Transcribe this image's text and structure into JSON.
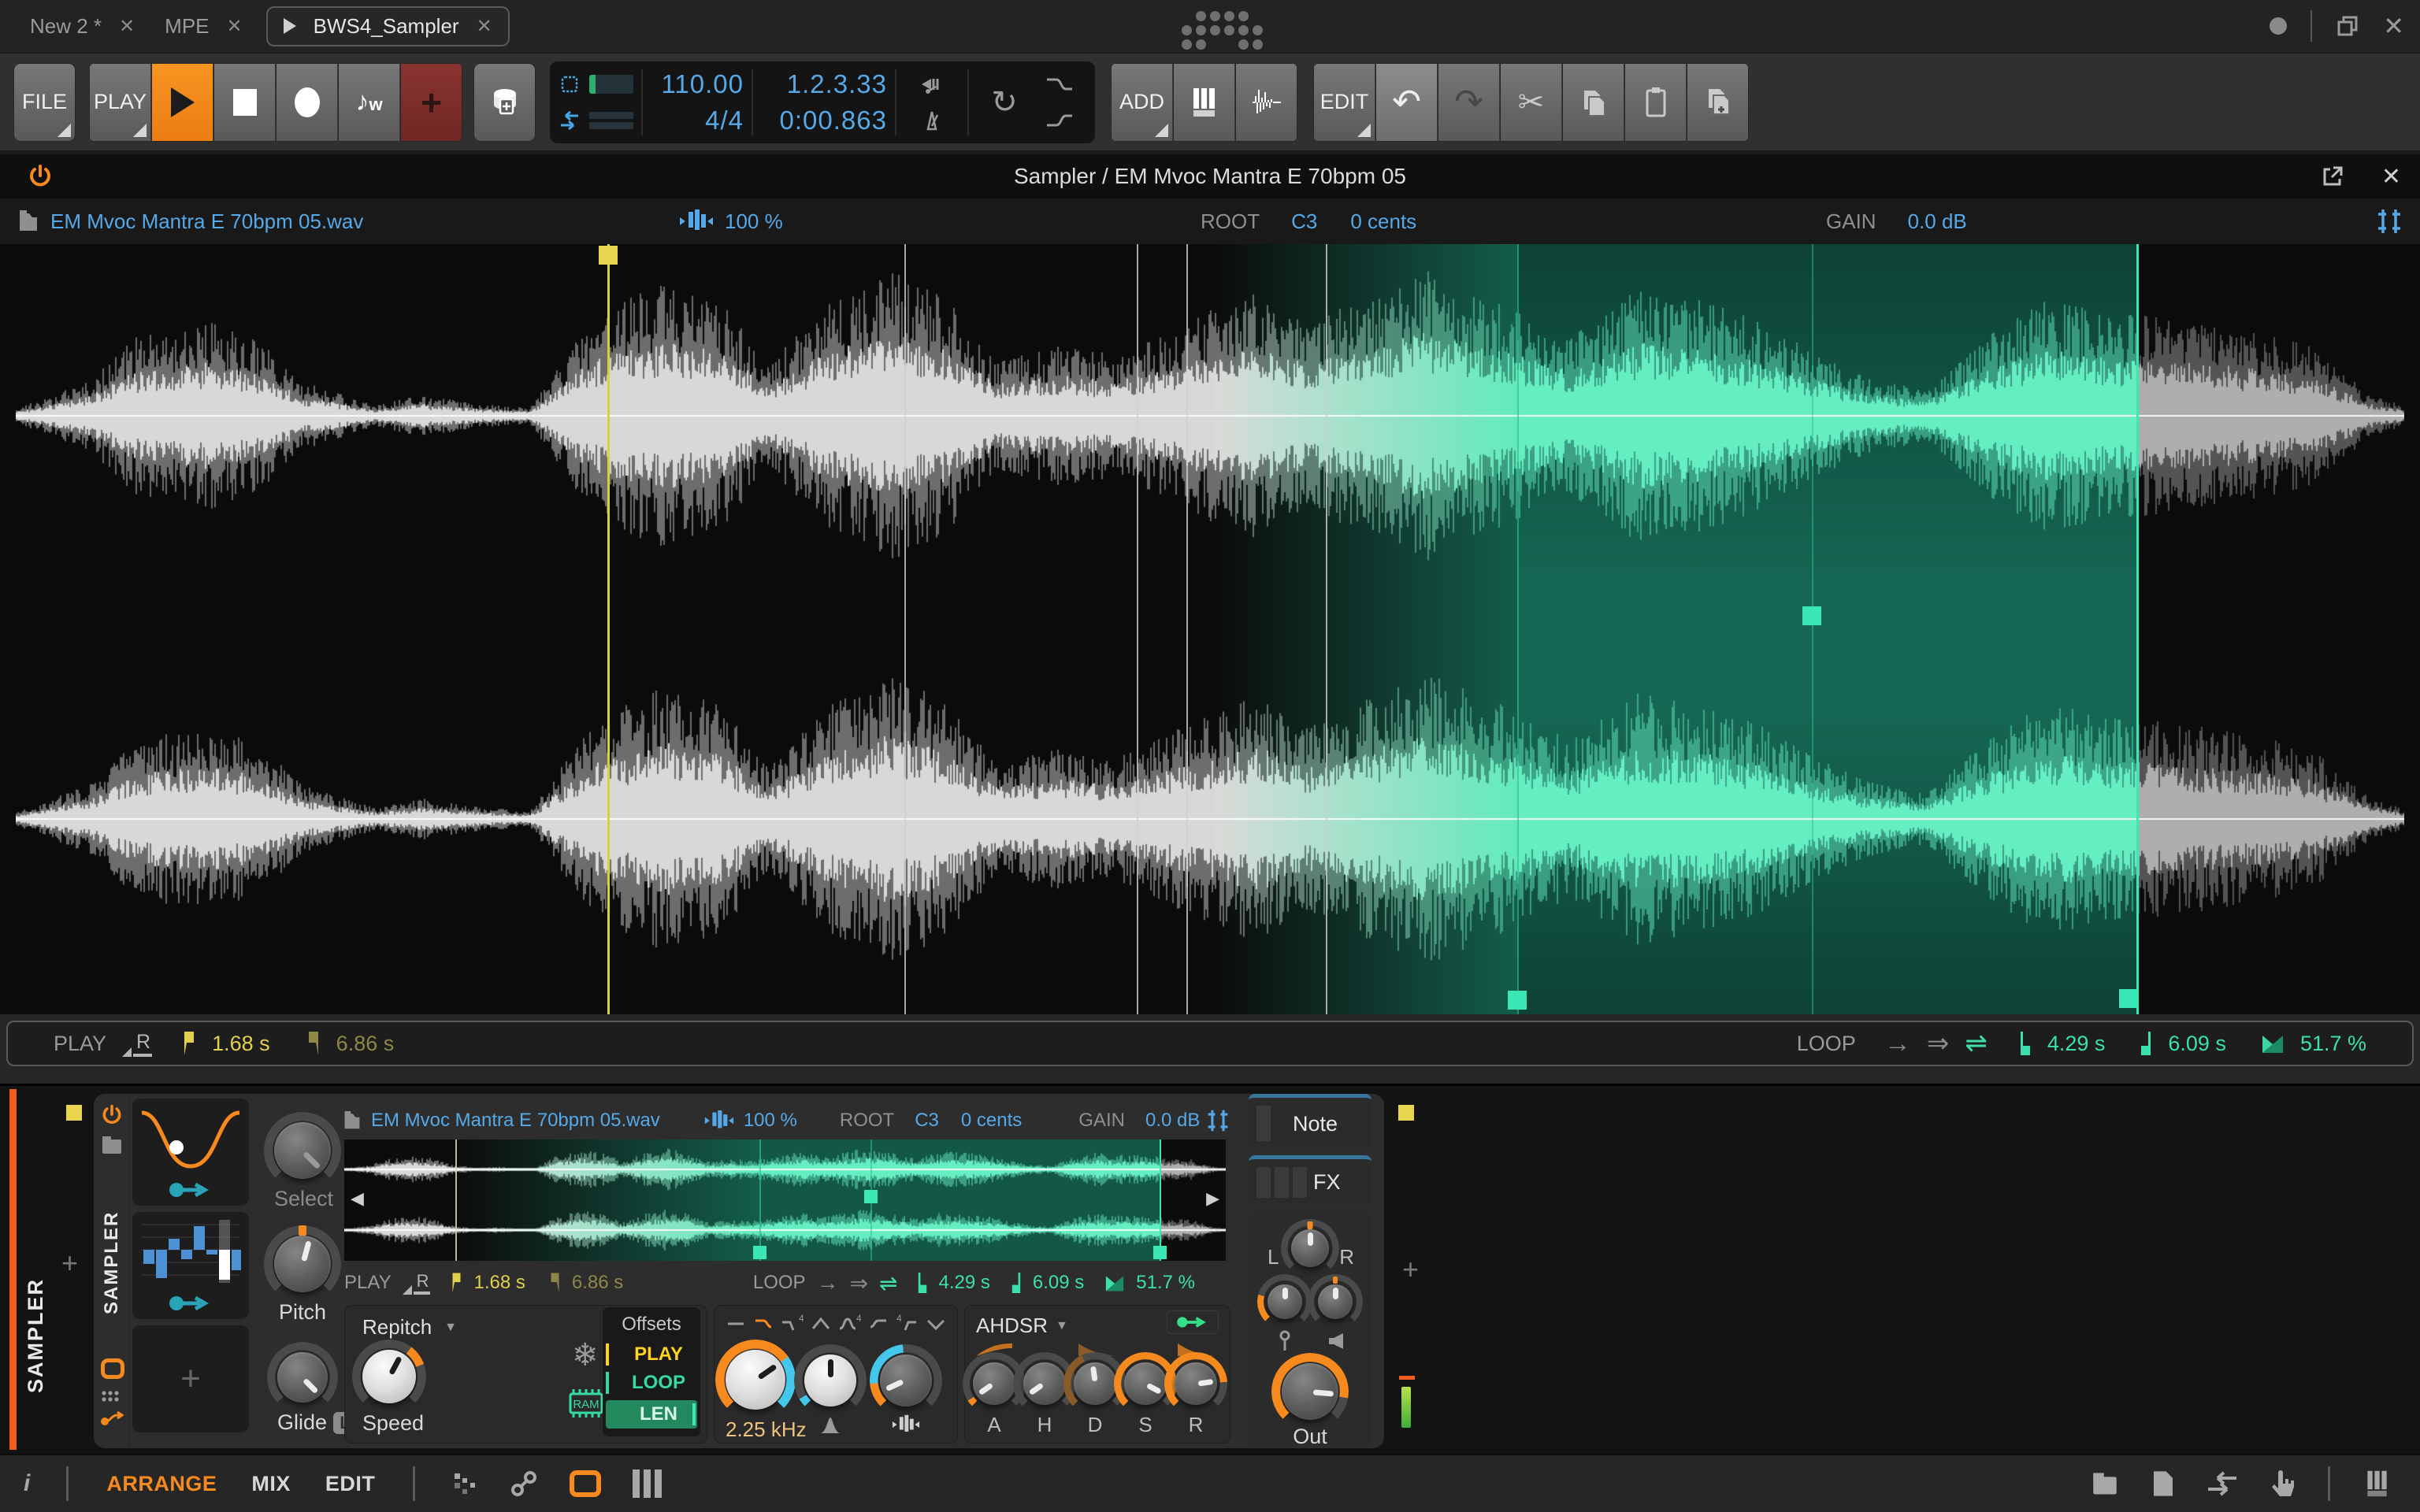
{
  "colors": {
    "orange": "#f68a1e",
    "blue": "#56a9e8",
    "teal": "#35e3ae",
    "yellow": "#e8d44d",
    "record_red": "#8a3431",
    "loop_bg_green": "#145846"
  },
  "glyphs": {
    "play": "▶",
    "stop": "■",
    "record": "●",
    "plus": "+",
    "close": "✕",
    "minimize": "●",
    "note": "♪",
    "note_w": "w",
    "arrow_once": "→",
    "arrow_loop": "⇒",
    "arrow_pingpong": "⇌",
    "scissors": "✂",
    "undo": "↶",
    "redo": "↷",
    "snowflake": "❄",
    "chevron_down": "▼",
    "prev": "◀",
    "next": "▶",
    "info": "i",
    "loop_transport": "↻"
  },
  "window": {
    "tabs": [
      {
        "label": "New 2 *"
      },
      {
        "label": "MPE"
      },
      {
        "label": "BWS4_Sampler"
      }
    ]
  },
  "transport": {
    "file": "FILE",
    "play": "PLAY",
    "add": "ADD",
    "edit": "EDIT",
    "tempo": "110.00",
    "time_signature": "4/4",
    "position": "1.2.3.33",
    "time": "0:00.863"
  },
  "editor": {
    "title": "Sampler / EM Mvoc Mantra E 70bpm 05",
    "file_name": "EM Mvoc Mantra E 70bpm 05.wav",
    "stretch": "100 %",
    "root_label": "ROOT",
    "root_note": "C3",
    "root_cents": "0 cents",
    "gain_label": "GAIN",
    "gain_value": "0.0 dB",
    "play_label": "PLAY",
    "play_mode": "R",
    "play_start": "1.68 s",
    "play_end": "6.86 s",
    "loop_label": "LOOP",
    "loop_start": "4.29 s",
    "loop_end": "6.09 s",
    "loop_crossfade": "51.7 %"
  },
  "device": {
    "track_name": "SAMPLER",
    "device_name": "SAMPLER",
    "select_label": "Select",
    "pitch_label": "Pitch",
    "glide_label": "Glide",
    "glide_badge": "L",
    "mode": "Repitch",
    "speed_label": "Speed",
    "ram_label": "RAM",
    "offsets": {
      "title": "Offsets",
      "play": "PLAY",
      "loop": "LOOP",
      "len": "LEN"
    },
    "filter_cutoff": "2.25 kHz",
    "envelope_name": "AHDSR",
    "env_a": "A",
    "env_h": "H",
    "env_d": "D",
    "env_s": "S",
    "env_r": "R",
    "out_label": "Out",
    "note_slot": "Note",
    "fx_slot": "FX",
    "pan_left": "L",
    "pan_right": "R"
  },
  "bottom_bar": {
    "views": [
      "ARRANGE",
      "MIX",
      "EDIT"
    ]
  }
}
